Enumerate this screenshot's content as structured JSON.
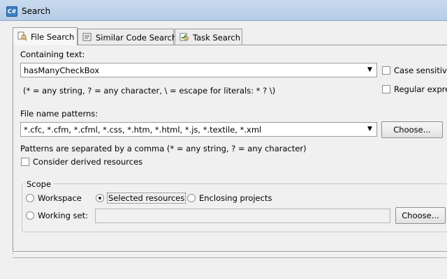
{
  "window": {
    "title": "Search",
    "icon_text": "C#"
  },
  "tabs": [
    {
      "label": "File Search",
      "icon": "file-search-icon",
      "active": true
    },
    {
      "label": "Similar Code Search",
      "icon": "code-search-icon",
      "active": false
    },
    {
      "label": "Task Search",
      "icon": "task-search-icon",
      "active": false
    }
  ],
  "containing_text": {
    "label": "Containing text:",
    "value": "hasManyCheckBox",
    "hint": "(* = any string, ? = any character, \\ = escape for literals: * ? \\)",
    "case_sensitive_label": "Case sensitive",
    "regex_label": "Regular expres",
    "case_sensitive_checked": false,
    "regex_checked": false
  },
  "file_name": {
    "label": "File name patterns:",
    "value": "*.cfc, *.cfm, *.cfml, *.css, *.htm, *.html, *.js, *.textile, *.xml",
    "choose_label": "Choose...",
    "hint": "Patterns are separated by a comma (* = any string, ? = any character)",
    "derived_label": "Consider derived resources",
    "derived_checked": false
  },
  "scope": {
    "legend": "Scope",
    "workspace_label": "Workspace",
    "selected_label": "Selected resources",
    "enclosing_label": "Enclosing projects",
    "working_set_label": "Working set:",
    "working_set_value": "",
    "choose_label": "Choose...",
    "selected_option": "Selected resources"
  }
}
